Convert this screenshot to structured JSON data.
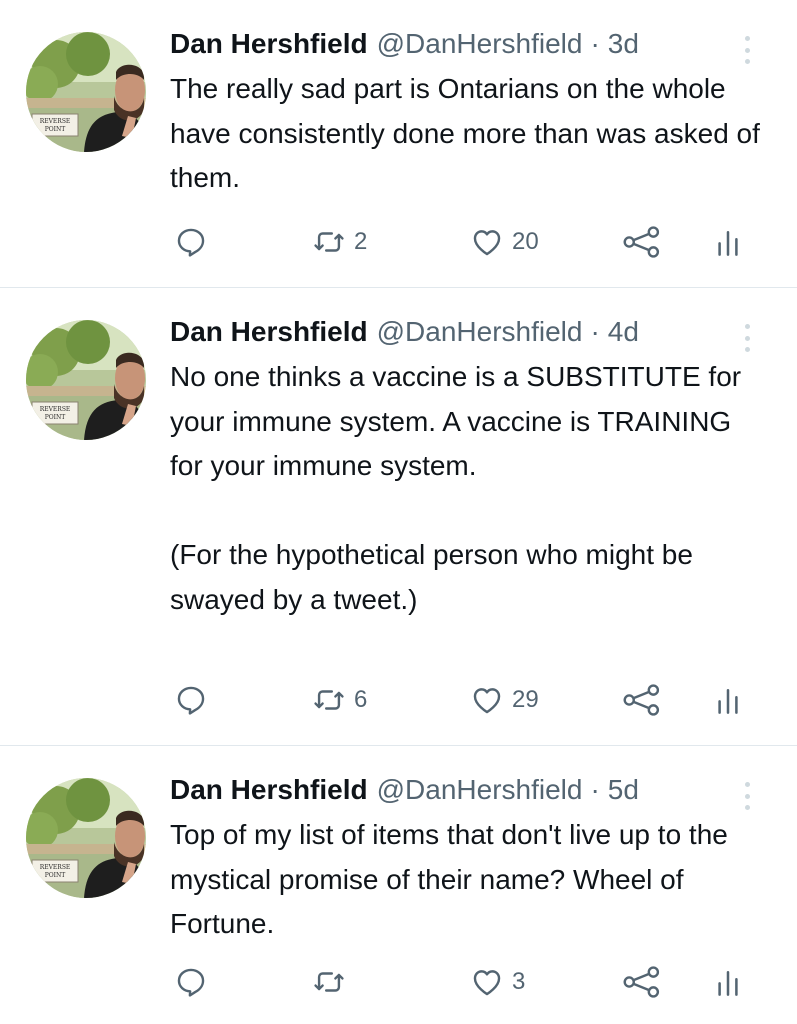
{
  "colors": {
    "text": "#0f1419",
    "secondary": "#536471",
    "divider": "#e1e8ed"
  },
  "tweets": [
    {
      "author": "Dan Hershfield",
      "handle": "@DanHershfield",
      "separator": "·",
      "time": "3d",
      "paragraphs": [
        "The really sad part is Ontarians on the whole have consistently done more than was asked of them."
      ],
      "replies": "",
      "retweets": "2",
      "likes": "20",
      "avatar_sign": [
        "REVERSE",
        "POINT"
      ]
    },
    {
      "author": "Dan Hershfield",
      "handle": "@DanHershfield",
      "separator": "·",
      "time": "4d",
      "paragraphs": [
        "No one thinks a vaccine is a SUBSTITUTE for your immune system. A vaccine is TRAINING for your immune system.",
        "(For the hypothetical person who might be swayed by a tweet.)"
      ],
      "replies": "",
      "retweets": "6",
      "likes": "29",
      "avatar_sign": [
        "REVERSE",
        "POINT"
      ]
    },
    {
      "author": "Dan Hershfield",
      "handle": "@DanHershfield",
      "separator": "·",
      "time": "5d",
      "paragraphs": [
        "Top of my list of items that don't live up to the mystical promise of their name? Wheel of Fortune."
      ],
      "replies": "",
      "retweets": "",
      "likes": "3",
      "avatar_sign": [
        "REVERSE",
        "POINT"
      ]
    }
  ]
}
